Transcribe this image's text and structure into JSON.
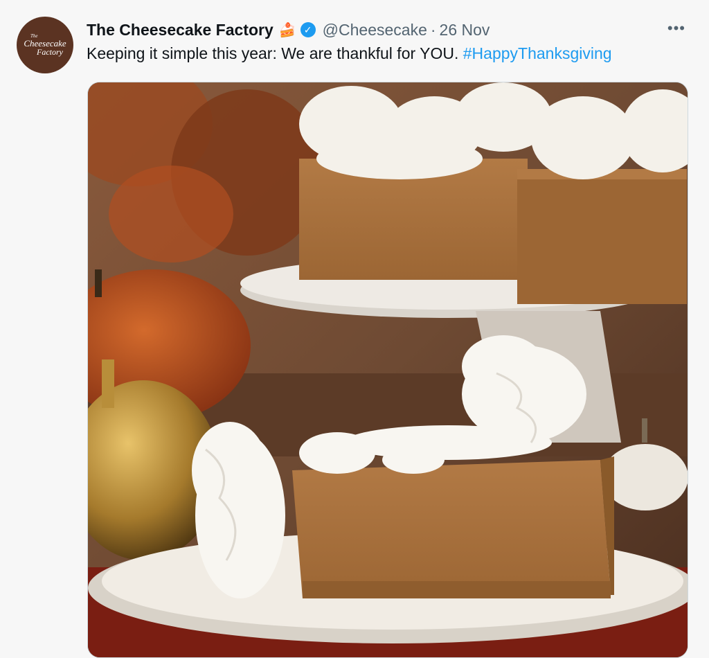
{
  "tweet": {
    "author_name": "The Cheesecake Factory",
    "author_emoji": "🍰",
    "handle": "@Cheesecake",
    "separator": "·",
    "date": "26 Nov",
    "more_label": "•••",
    "text": "Keeping it simple this year: We are thankful for YOU.",
    "hashtag": "#HappyThanksgiving",
    "avatar": {
      "line1": "Cheesecake",
      "line2": "Factory",
      "small": "The"
    }
  },
  "colors": {
    "link": "#1d9bf0",
    "secondary_text": "#536471",
    "verified_badge": "#1d9bf0",
    "avatar_bg": "#5b3322"
  },
  "icons": {
    "verified": "verified-badge-icon",
    "more": "more-options-icon"
  }
}
